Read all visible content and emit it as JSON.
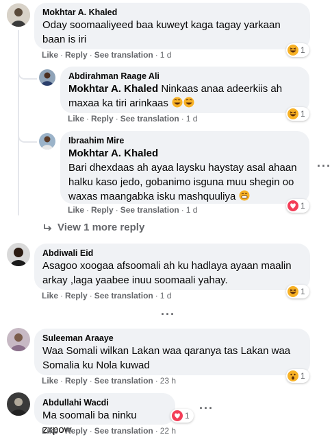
{
  "comments": [
    {
      "author": "Mokhtar A. Khaled",
      "text": "Oday soomaaliyeed baa kuweyt kaga tagay yarkaan baan is iri",
      "actions": {
        "like": "Like",
        "reply": "Reply",
        "translate": "See translation",
        "time": "1 d"
      },
      "reaction": {
        "type": "haha",
        "count": "1"
      }
    },
    {
      "author": "Abdirahman Raage Ali",
      "tag": "Mokhtar A. Khaled",
      "text": "Ninkaas anaa adeerkiis ah maxaa ka tiri arinkaas",
      "actions": {
        "like": "Like",
        "reply": "Reply",
        "translate": "See translation",
        "time": "1 d"
      },
      "reaction": {
        "type": "haha",
        "count": "1"
      }
    },
    {
      "author": "Ibraahim Mire",
      "tag": "Mokhtar A. Khaled",
      "text": "Bari dhexdaas ah ayaa laysku haystay asal ahaan halku kaso jedo, gobanimo isguna muu shegin oo waxas maangabka isku mashquuliya",
      "actions": {
        "like": "Like",
        "reply": "Reply",
        "translate": "See translation",
        "time": "1 d"
      },
      "reaction": {
        "type": "love",
        "count": "1"
      }
    },
    {
      "author": "Abdiwali Eid",
      "text": "Asagoo xoogaa afsoomali ah ku hadlaya ayaan maalin arkay ,laga yaabee inuu soomaali yahay.",
      "actions": {
        "like": "Like",
        "reply": "Reply",
        "translate": "See translation",
        "time": "1 d"
      },
      "reaction": {
        "type": "haha",
        "count": "1"
      }
    },
    {
      "author": "Suleeman Araaye",
      "text": "Waa Somali wilkan Lakan waa qaranya tas Lakan waa Somalia ku Nola kuwad",
      "actions": {
        "like": "Like",
        "reply": "Reply",
        "translate": "See translation",
        "time": "23 h"
      },
      "reaction": {
        "type": "wow",
        "count": "1"
      }
    },
    {
      "author": "Abdullahi Wacdi",
      "text": "Ma soomali ba ninku zxpow",
      "actions": {
        "like": "Like",
        "reply": "Reply",
        "translate": "See translation",
        "time": "22 h"
      },
      "reaction": {
        "type": "love",
        "count": "1"
      }
    }
  ],
  "view_more": "View 1 more reply",
  "colors": {
    "bubble": "#f0f2f5",
    "meta": "#65676b",
    "love": "#f33e58",
    "haha": "#f7b125"
  }
}
